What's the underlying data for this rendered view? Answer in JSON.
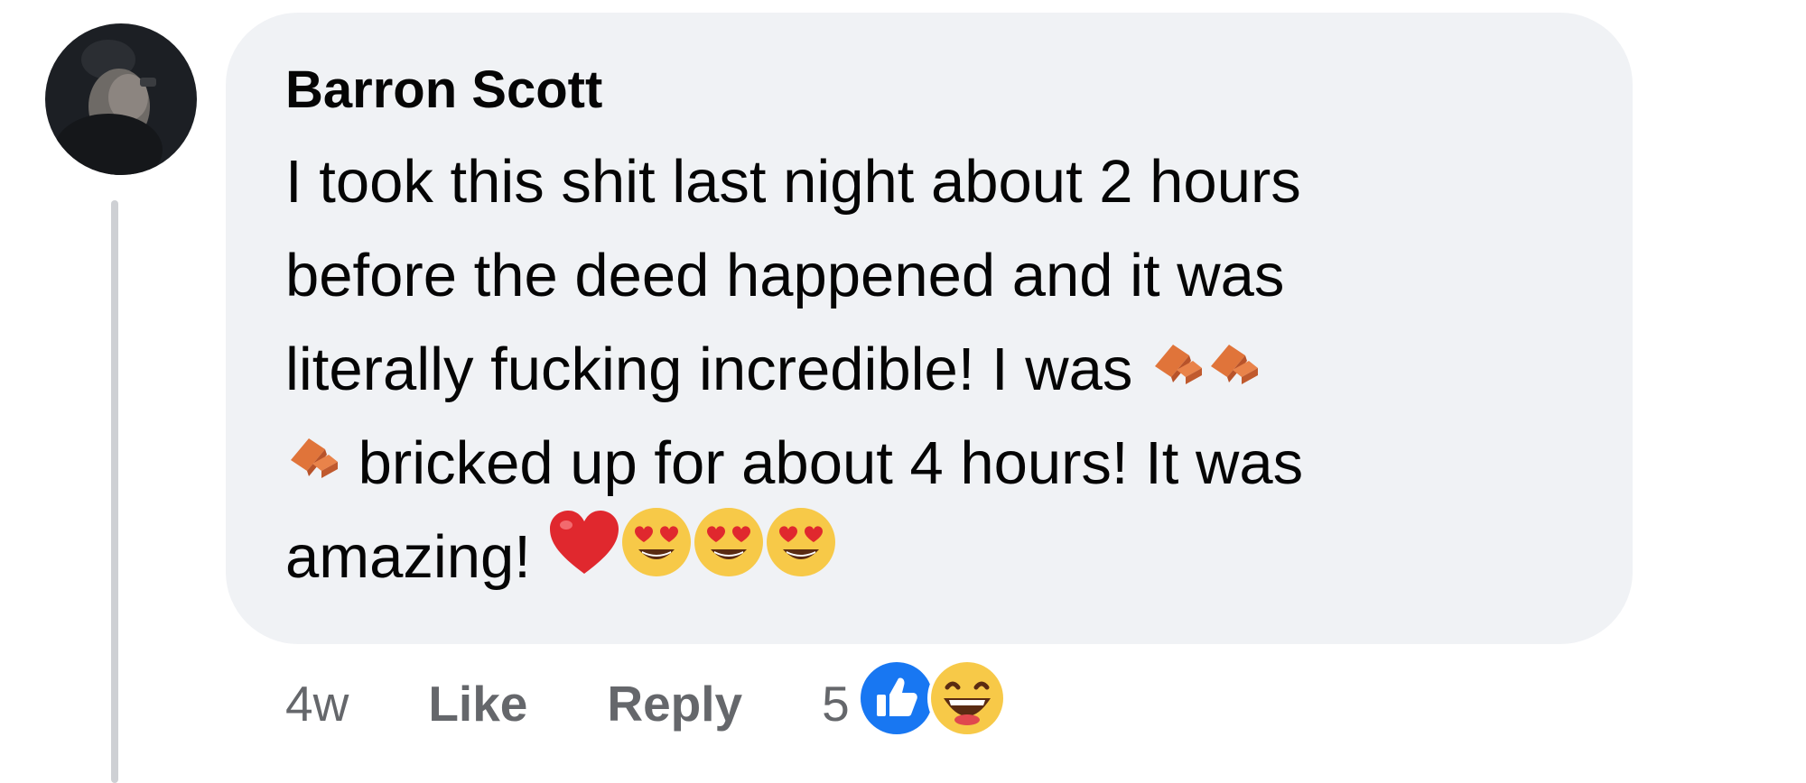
{
  "comment": {
    "author": "Barron Scott",
    "lines": [
      {
        "text": "I took this shit last night about 2 hours",
        "after_emojis": []
      },
      {
        "text": "before the deed happened and it was",
        "after_emojis": []
      },
      {
        "text": "literally fucking incredible! I was",
        "after_emojis": [
          "brick-emoji",
          "brick-emoji"
        ]
      },
      {
        "before_emojis": [
          "brick-emoji"
        ],
        "text": "bricked up for about 4 hours! It was"
      },
      {
        "text": "amazing!",
        "after_emojis": [
          "red-heart-emoji",
          "heart-eyes-emoji",
          "heart-eyes-emoji",
          "heart-eyes-emoji"
        ]
      }
    ],
    "line1": "I took this shit last night about 2 hours",
    "line2": "before the deed happened and it was",
    "line3": "literally fucking incredible! I was",
    "line4": "bricked up for about 4 hours! It was",
    "line5": "amazing!"
  },
  "meta": {
    "timestamp": "4w",
    "like_label": "Like",
    "reply_label": "Reply",
    "reaction_count": "5",
    "reaction_icons": [
      "like-reaction-icon",
      "haha-reaction-icon"
    ]
  },
  "colors": {
    "bubble_bg": "#f0f2f5",
    "meta_text": "#65676b",
    "like_blue": "#1877f2",
    "thread_line": "#ced0d4"
  }
}
